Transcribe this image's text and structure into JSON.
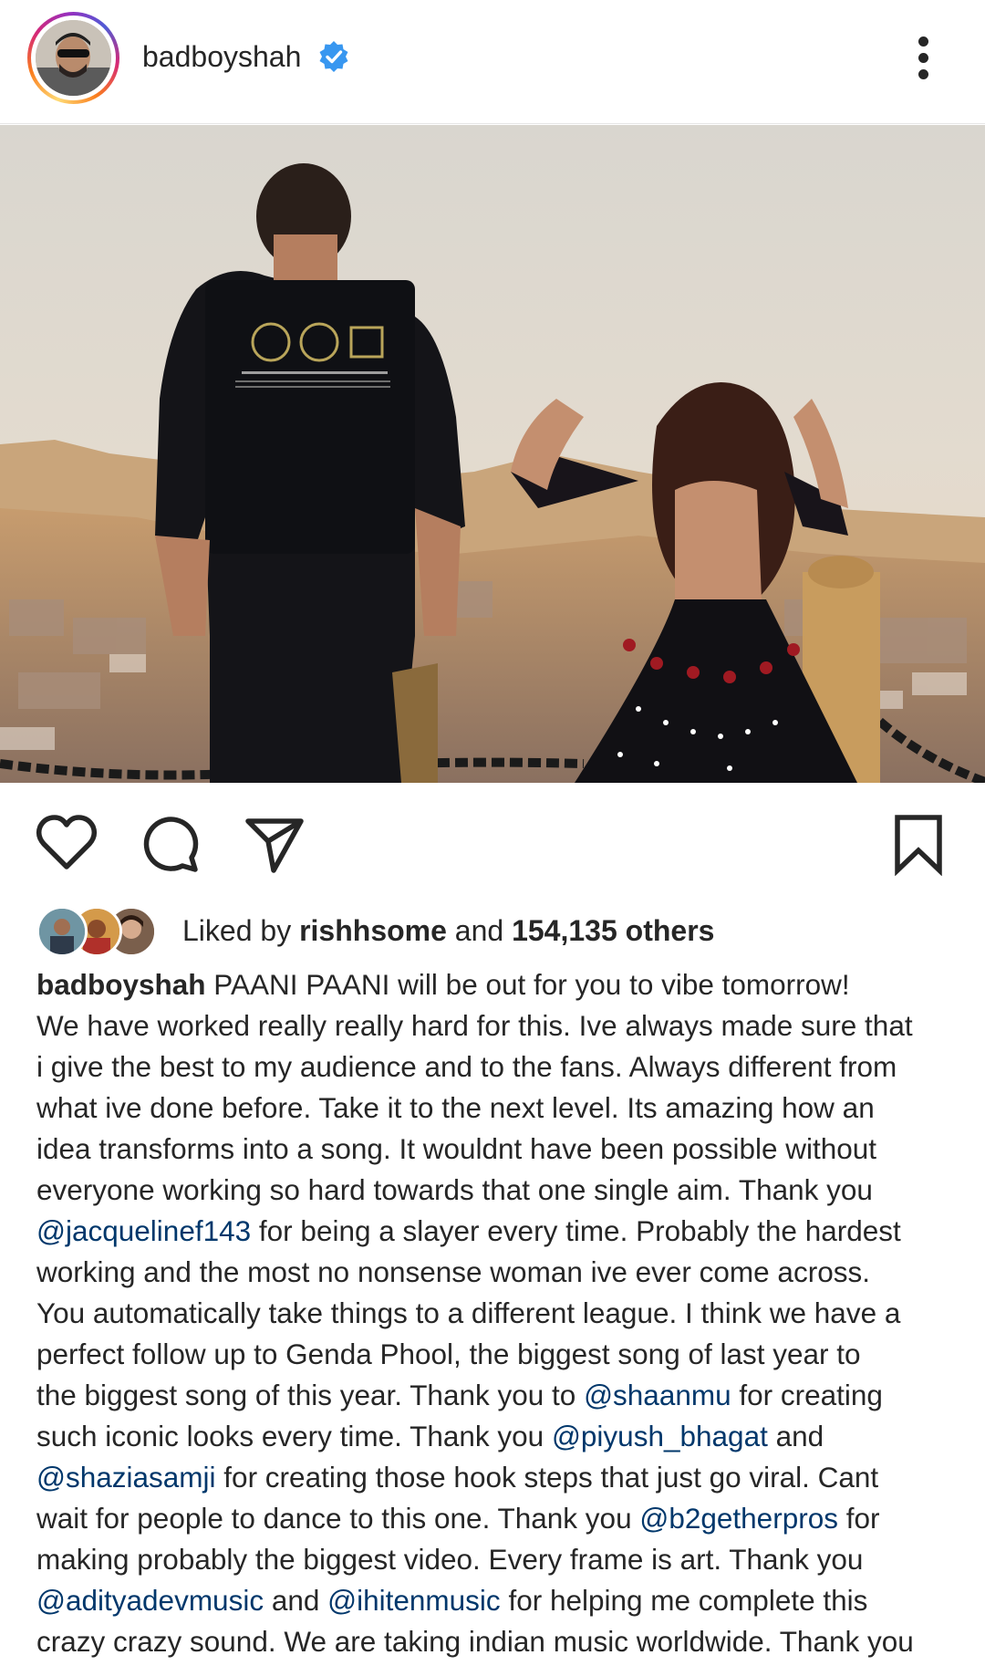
{
  "header": {
    "username": "badboyshah",
    "verified": true
  },
  "post": {
    "likes": {
      "prefix": "Liked by ",
      "first_liker": "rishhsome",
      "joiner": " and ",
      "others": "154,135 others"
    },
    "caption": {
      "username": "badboyshah",
      "lines": [
        [
          {
            "t": "PAANI PAANI will be out for you to vibe tomorrow!"
          }
        ],
        [
          {
            "t": "We have worked really really hard for this. Ive always made sure that"
          }
        ],
        [
          {
            "t": "i give the best to my audience and to the fans. Always different from"
          }
        ],
        [
          {
            "t": "what ive done before. Take it to the next level. Its amazing how an"
          }
        ],
        [
          {
            "t": "idea transforms into a song. It wouldnt have been possible without"
          }
        ],
        [
          {
            "t": "everyone working so hard towards that one single aim. Thank you"
          }
        ],
        [
          {
            "t": "@jacquelinef143",
            "m": true
          },
          {
            "t": " for being a slayer every time. Probably the hardest"
          }
        ],
        [
          {
            "t": "working and the most no nonsense woman ive ever come across."
          }
        ],
        [
          {
            "t": "You automatically take things to a different league. I think we have a"
          }
        ],
        [
          {
            "t": "perfect follow up to Genda Phool, the biggest song of last year to"
          }
        ],
        [
          {
            "t": "the biggest song of this year. Thank you to "
          },
          {
            "t": "@shaanmu",
            "m": true
          },
          {
            "t": " for creating"
          }
        ],
        [
          {
            "t": "such iconic looks every time. Thank you "
          },
          {
            "t": "@piyush_bhagat",
            "m": true
          },
          {
            "t": " and"
          }
        ],
        [
          {
            "t": "@shaziasamji",
            "m": true
          },
          {
            "t": " for creating those hook steps that just go viral. Cant"
          }
        ],
        [
          {
            "t": "wait for people to dance to this one. Thank you "
          },
          {
            "t": "@b2getherpros",
            "m": true
          },
          {
            "t": " for"
          }
        ],
        [
          {
            "t": "making probably the biggest video. Every frame is art. Thank you"
          }
        ],
        [
          {
            "t": "@adityadevmusic",
            "m": true
          },
          {
            "t": " and "
          },
          {
            "t": "@ihitenmusic",
            "m": true
          },
          {
            "t": " for helping me complete this"
          }
        ],
        [
          {
            "t": "crazy crazy sound. We are taking indian music worldwide. Thank you"
          }
        ]
      ]
    }
  },
  "icons": {
    "like": "heart-icon",
    "comment": "comment-icon",
    "share": "send-icon",
    "save": "bookmark-icon",
    "more": "more-vertical-icon",
    "verified": "verified-badge-icon"
  },
  "colors": {
    "text": "#262626",
    "mention": "#00376b",
    "verified_blue": "#3897f0"
  }
}
